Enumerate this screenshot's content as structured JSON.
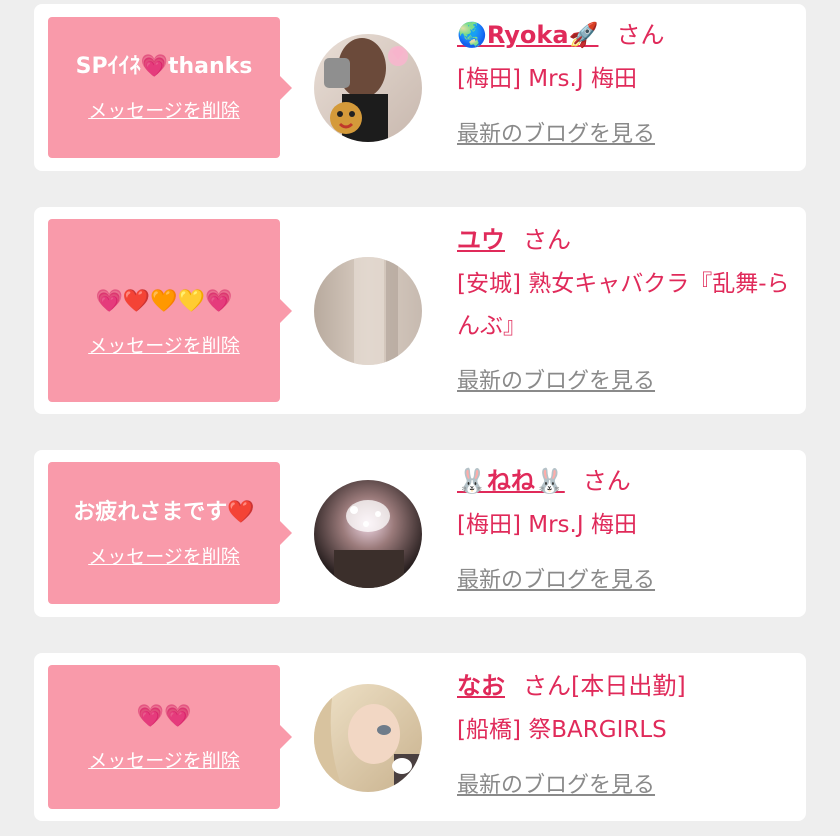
{
  "colors": {
    "background": "#eeeeee",
    "card": "#ffffff",
    "bubble": "#f99aaa",
    "name": "#e02a5a",
    "link_gray": "#8a8a8a"
  },
  "entries": [
    {
      "message": "SPｲｲﾈ💗thanks",
      "delete_label": "メッセージを削除",
      "name": "🌏Ryoka🚀",
      "honorific": "さん",
      "extra": "",
      "shop": "[梅田] Mrs.J 梅田",
      "blog_link": "最新のブログを見る"
    },
    {
      "message": "💗❤️🧡💛💗",
      "delete_label": "メッセージを削除",
      "name": "ユウ",
      "honorific": "さん",
      "extra": "",
      "shop": "[安城] 熟女キャバクラ『乱舞-らんぶ』",
      "blog_link": "最新のブログを見る"
    },
    {
      "message": "お疲れさまです❤️",
      "delete_label": "メッセージを削除",
      "name": "🐰ねね🐰",
      "honorific": "さん",
      "extra": "",
      "shop": "[梅田] Mrs.J 梅田",
      "blog_link": "最新のブログを見る"
    },
    {
      "message": "💗💗",
      "delete_label": "メッセージを削除",
      "name": "なお",
      "honorific": "さん",
      "extra": "[本日出勤]",
      "shop": "[船橋] 祭BARGIRLS",
      "blog_link": "最新のブログを見る"
    }
  ]
}
